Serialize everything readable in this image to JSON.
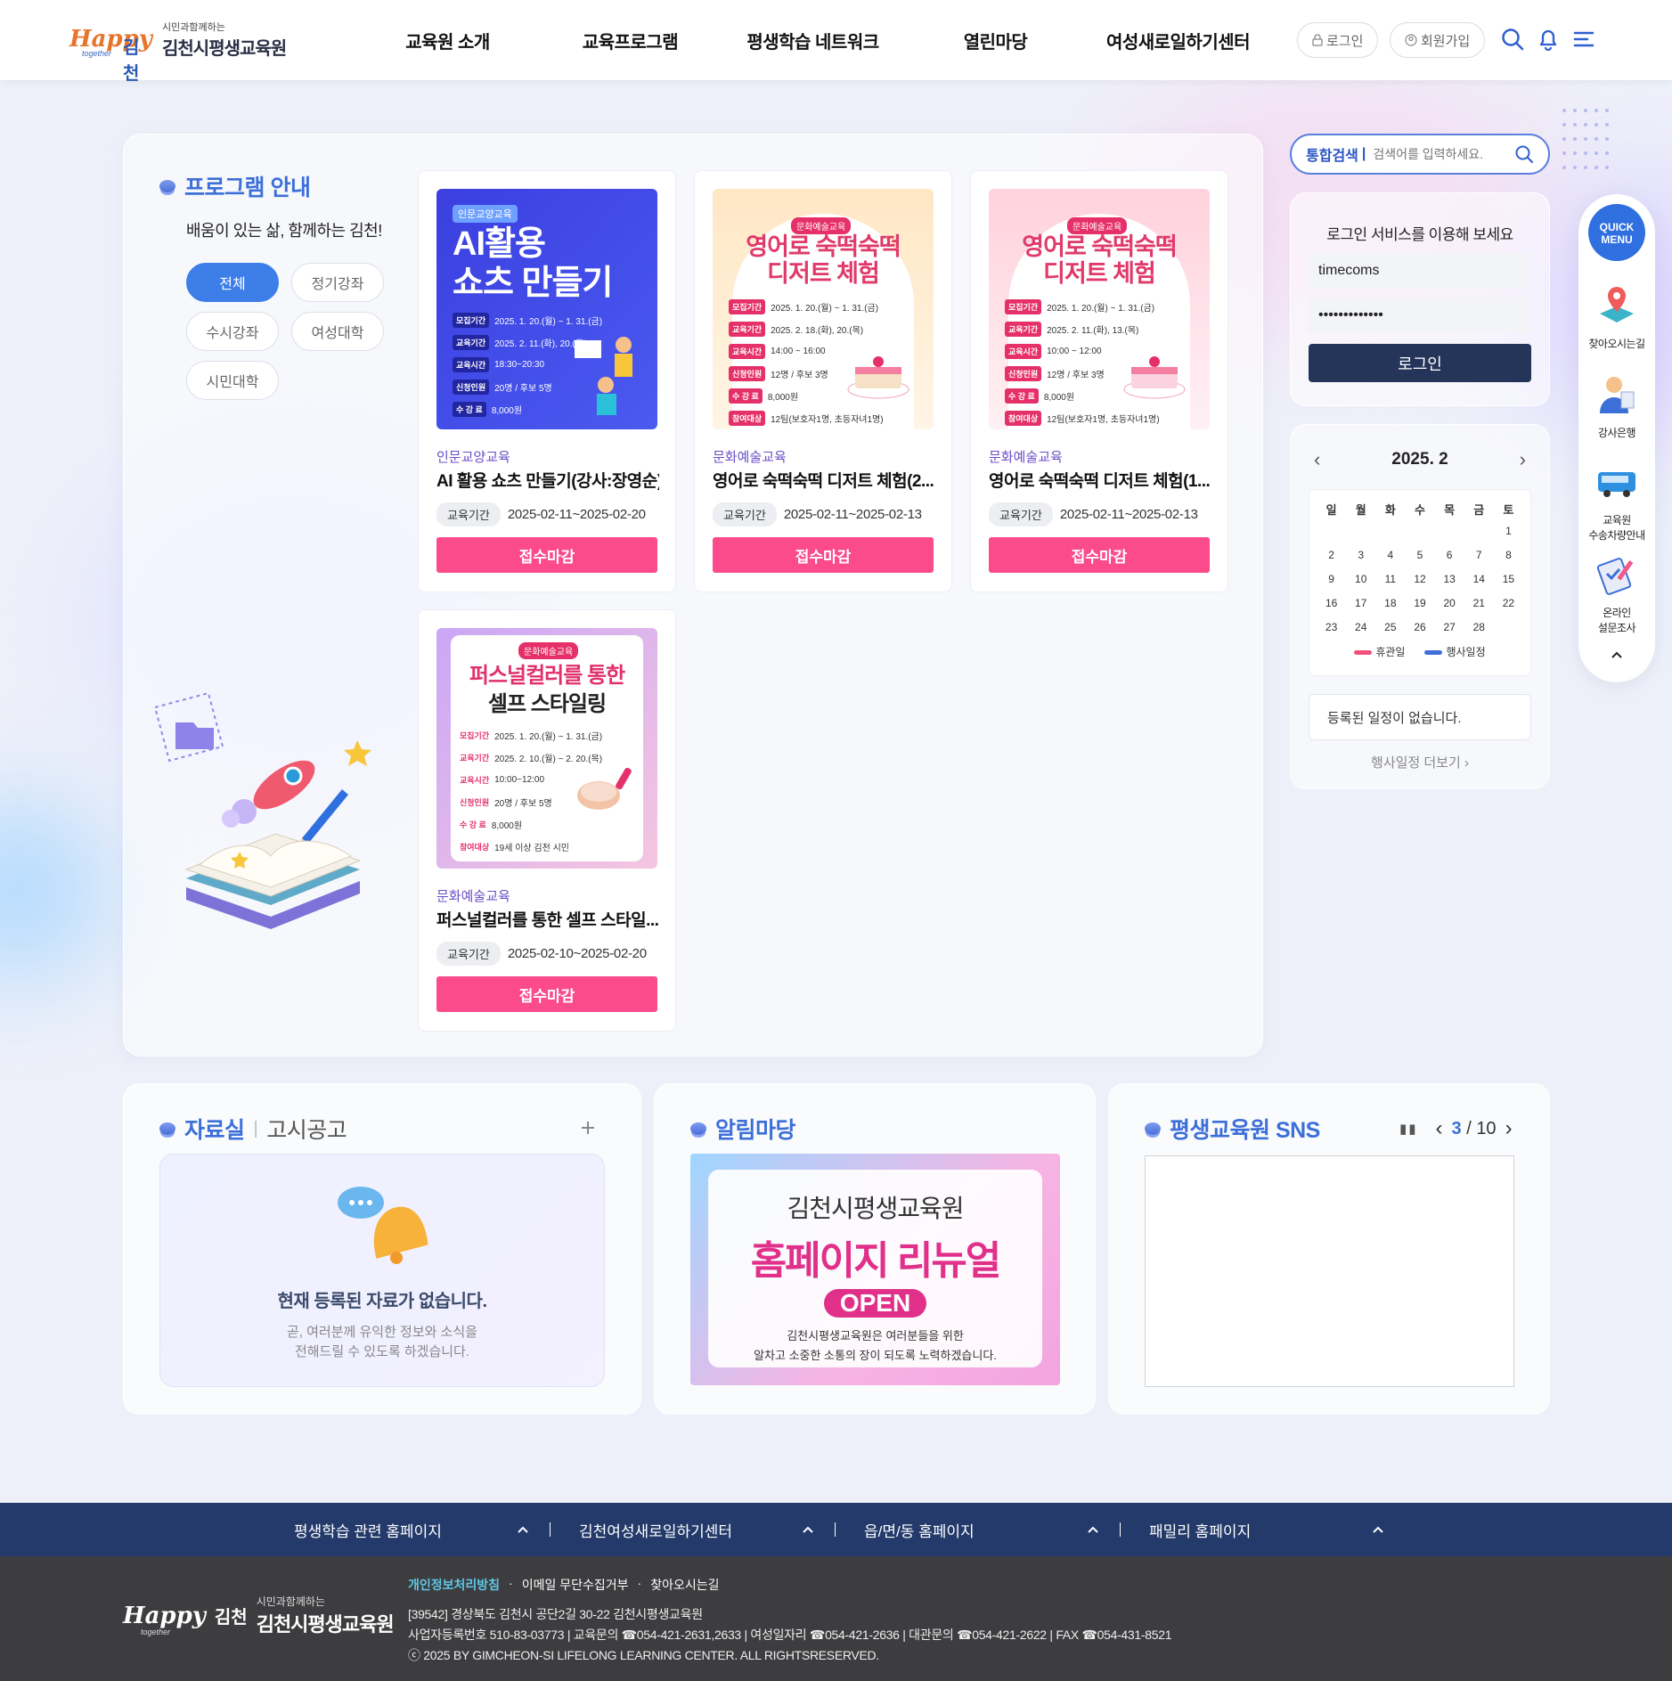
{
  "header": {
    "logo_small": "시민과함께하는",
    "logo_name": "김천시평생교육원",
    "logo_mark_happy": "Happy",
    "logo_mark_together": "together",
    "logo_mark_city": "김천",
    "nav": [
      "교육원 소개",
      "교육프로그램",
      "평생학습 네트워크",
      "열린마당",
      "여성새로일하기센터"
    ],
    "login_label": "로그인",
    "join_label": "회원가입"
  },
  "program": {
    "title": "프로그램 안내",
    "subtitle": "배움이 있는 삶, 함께하는 김천!",
    "filters": [
      "전체",
      "정기강좌",
      "수시강좌",
      "여성대학",
      "시민대학"
    ],
    "active_filter": "전체",
    "cards": [
      {
        "category": "인문교양교육",
        "title": "AI 활용 쇼츠 만들기(강사:장영순)",
        "period_label": "교육기간",
        "period": "2025-02-11~2025-02-20",
        "button": "접수마감",
        "poster": {
          "chip": "인문교양교육",
          "headline1": "AI활용",
          "headline2": "쇼츠 만들기",
          "rows": [
            {
              "label": "모집기간",
              "value": "2025. 1. 20.(월) ~ 1. 31.(금)"
            },
            {
              "label": "교육기간",
              "value": "2025. 2. 11.(화), 20.(목)"
            },
            {
              "label": "교육시간",
              "value": "18:30~20:30"
            },
            {
              "label": "신청인원",
              "value": "20명 / 후보 5명"
            },
            {
              "label": "수 강 료",
              "value": "8,000원"
            }
          ]
        }
      },
      {
        "category": "문화예술교육",
        "title": "영어로 숙떡숙떡 디저트 체험(2...",
        "period_label": "교육기간",
        "period": "2025-02-11~2025-02-13",
        "button": "접수마감",
        "poster": {
          "chip": "문화예술교육",
          "headline1": "영어로 숙떡숙떡",
          "headline2": "디저트 체험",
          "rows": [
            {
              "label": "모집기간",
              "value": "2025. 1. 20.(월) ~ 1. 31.(금)"
            },
            {
              "label": "교육기간",
              "value": "2025. 2. 18.(화), 20.(목)"
            },
            {
              "label": "교육시간",
              "value": "14:00 ~ 16:00"
            },
            {
              "label": "신청인원",
              "value": "12명 / 후보 3명"
            },
            {
              "label": "수 강 료",
              "value": "8,000원"
            },
            {
              "label": "참여대상",
              "value": "12팀(보호자1명, 초등자녀1명)"
            }
          ]
        }
      },
      {
        "category": "문화예술교육",
        "title": "영어로 숙떡숙떡 디저트 체험(1...",
        "period_label": "교육기간",
        "period": "2025-02-11~2025-02-13",
        "button": "접수마감",
        "poster": {
          "chip": "문화예술교육",
          "headline1": "영어로 숙떡숙떡",
          "headline2": "디저트 체험",
          "rows": [
            {
              "label": "모집기간",
              "value": "2025. 1. 20.(월) ~ 1. 31.(금)"
            },
            {
              "label": "교육기간",
              "value": "2025. 2. 11.(화), 13.(목)"
            },
            {
              "label": "교육시간",
              "value": "10:00 ~ 12:00"
            },
            {
              "label": "신청인원",
              "value": "12명 / 후보 3명"
            },
            {
              "label": "수 강 료",
              "value": "8,000원"
            },
            {
              "label": "참여대상",
              "value": "12팀(보호자1명, 초등자녀1명)"
            }
          ]
        }
      },
      {
        "category": "문화예술교육",
        "title": "퍼스널컬러를 통한 셀프 스타일...",
        "period_label": "교육기간",
        "period": "2025-02-10~2025-02-20",
        "button": "접수마감",
        "poster": {
          "chip": "문화예술교육",
          "headline1": "퍼스널컬러를 통한",
          "headline2": "셀프 스타일링",
          "rows": [
            {
              "label": "모집기간",
              "value": "2025. 1. 20.(월) ~ 1. 31.(금)"
            },
            {
              "label": "교육기간",
              "value": "2025. 2. 10.(월) ~ 2. 20.(목)"
            },
            {
              "label": "교육시간",
              "value": "10:00~12:00"
            },
            {
              "label": "신청인원",
              "value": "20명 / 후보 5명"
            },
            {
              "label": "수 강 료",
              "value": "8,000원"
            },
            {
              "label": "참여대상",
              "value": "19세 이상 김천 시민"
            }
          ]
        }
      }
    ]
  },
  "search": {
    "label": "통합검색",
    "placeholder": "검색어를 입력하세요."
  },
  "login": {
    "title": "로그인 서비스를 이용해 보세요",
    "user_id": "timecoms",
    "password": "•••••••••••••",
    "button": "로그인"
  },
  "calendar": {
    "month": "2025. 2",
    "weekdays": [
      "일",
      "월",
      "화",
      "수",
      "목",
      "금",
      "토"
    ],
    "days": [
      "",
      "",
      "",
      "",
      "",
      "",
      "1",
      "2",
      "3",
      "4",
      "5",
      "6",
      "7",
      "8",
      "9",
      "10",
      "11",
      "12",
      "13",
      "14",
      "15",
      "16",
      "17",
      "18",
      "19",
      "20",
      "21",
      "22",
      "23",
      "24",
      "25",
      "26",
      "27",
      "28",
      ""
    ],
    "legend_holiday": "휴관일",
    "legend_event": "행사일정",
    "holiday_color": "#f0507a",
    "event_color": "#3d6fd8",
    "no_schedule": "등록된 일정이 없습니다.",
    "more": "행사일정 더보기"
  },
  "quick_menu": {
    "title_line1": "QUICK",
    "title_line2": "MENU",
    "items": [
      {
        "label1": "찾아오시는길",
        "label2": "",
        "icon": "map-pin-icon"
      },
      {
        "label1": "강사은행",
        "label2": "",
        "icon": "instructor-icon"
      },
      {
        "label1": "교육원",
        "label2": "수송차량안내",
        "icon": "bus-icon"
      },
      {
        "label1": "온라인",
        "label2": "설문조사",
        "icon": "survey-icon"
      }
    ]
  },
  "archive": {
    "title": "자료실",
    "tab2": "고시공고",
    "empty_title": "현재 등록된 자료가 없습니다.",
    "empty_desc1": "곧, 여러분께 유익한 정보와 소식을",
    "empty_desc2": "전해드릴 수 있도록 하겠습니다."
  },
  "notice": {
    "title": "알림마당",
    "banner_line1": "김천시평생교육원",
    "banner_line2": "홈페이지 리뉴얼",
    "banner_line3": "OPEN",
    "banner_desc1": "김천시평생교육원은 여러분들을 위한",
    "banner_desc2": "알차고 소중한 소통의 장이 되도록 노력하겠습니다."
  },
  "sns": {
    "title": "평생교육원 SNS",
    "current": "3",
    "total": "10"
  },
  "footer_bar": [
    "평생학습 관련 홈페이지",
    "김천여성새로일하기센터",
    "읍/면/동 홈페이지",
    "패밀리 홈페이지"
  ],
  "footer": {
    "links": [
      "개인정보처리방침",
      "이메일 무단수집거부",
      "찾아오시는길"
    ],
    "address": "[39542] 경상북도 김천시 공단2길 30-22 김천시평생교육원",
    "info": "사업자등록번호 510-83-03773  |  교육문의 ☎054-421-2631,2633  |  여성일자리 ☎054-421-2636  |  대관문의 ☎054-421-2622  |  FAX ☎054-431-8521",
    "copyright": "ⓒ 2025 BY GIMCHEON-SI LIFELONG LEARNING CENTER. ALL RIGHTSRESERVED.",
    "logo_small": "시민과함께하는",
    "logo_name": "김천시평생교육원",
    "logo_mark_happy": "Happy",
    "logo_mark_together": "together",
    "logo_mark_city": "김천"
  }
}
